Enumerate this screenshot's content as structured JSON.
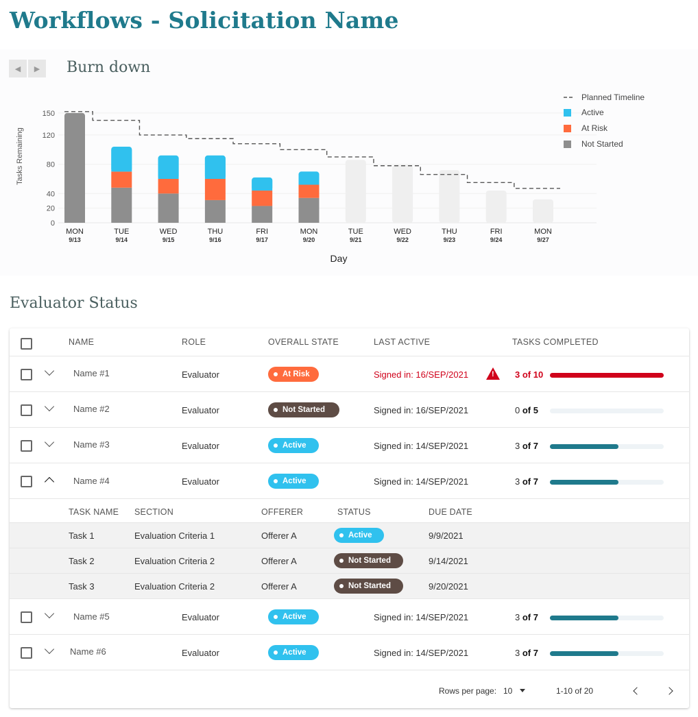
{
  "page": {
    "title": "Workflows - Solicitation Name"
  },
  "burndown": {
    "title": "Burn down",
    "prev_label": "◀",
    "next_label": "▶"
  },
  "chart_data": {
    "type": "bar",
    "xlabel": "Day",
    "ylabel": "Tasks Remaining",
    "ylim": [
      0,
      160
    ],
    "yticks": [
      0,
      20,
      40,
      80,
      120,
      150
    ],
    "categories": [
      "MON 9/13",
      "TUE 9/14",
      "WED 9/15",
      "THU 9/16",
      "FRI 9/17",
      "MON 9/20",
      "TUE 9/21",
      "WED 9/22",
      "THU 9/23",
      "FRI 9/24",
      "MON 9/27"
    ],
    "days": [
      "MON",
      "TUE",
      "WED",
      "THU",
      "FRI",
      "MON",
      "TUE",
      "WED",
      "THU",
      "FRI",
      "MON"
    ],
    "dates": [
      "9/13",
      "9/14",
      "9/15",
      "9/16",
      "9/17",
      "9/20",
      "9/21",
      "9/22",
      "9/23",
      "9/24",
      "9/27"
    ],
    "series": [
      {
        "name": "Not Started",
        "color": "#8e8e8e",
        "values": [
          150,
          48,
          40,
          31,
          23,
          34,
          null,
          null,
          null,
          null,
          null
        ]
      },
      {
        "name": "At Risk",
        "color": "#ff6b3d",
        "values": [
          0,
          22,
          20,
          29,
          21,
          18,
          null,
          null,
          null,
          null,
          null
        ]
      },
      {
        "name": "Active",
        "color": "#30c1ee",
        "values": [
          0,
          34,
          32,
          32,
          18,
          18,
          null,
          null,
          null,
          null,
          null
        ]
      }
    ],
    "projected": {
      "color": "#efefef",
      "values": [
        null,
        null,
        null,
        null,
        null,
        null,
        86,
        79,
        72,
        44,
        32
      ]
    },
    "planned_timeline": {
      "name": "Planned Timeline",
      "values": [
        152,
        140,
        120,
        115,
        108,
        100,
        90,
        78,
        66,
        55,
        47
      ]
    },
    "legend": [
      "Planned Timeline",
      "Active",
      "At Risk",
      "Not Started"
    ],
    "legend_position": "top-right",
    "grid": true
  },
  "evaluator": {
    "title": "Evaluator Status",
    "columns": {
      "name": "NAME",
      "role": "ROLE",
      "state": "OVERALL STATE",
      "last_active": "LAST ACTIVE",
      "tasks": "TASKS COMPLETED"
    },
    "rows": [
      {
        "name": "Name #1",
        "role": "Evaluator",
        "state": "At Risk",
        "last_active": "Signed in: 16/SEP/2021",
        "done": "3",
        "of_total": "of 10",
        "progress": 1.0
      },
      {
        "name": "Name #2",
        "role": "Evaluator",
        "state": "Not Started",
        "last_active": "Signed in: 16/SEP/2021",
        "done": "0",
        "of_total": "of 5",
        "progress": 0.0
      },
      {
        "name": "Name #3",
        "role": "Evaluator",
        "state": "Active",
        "last_active": "Signed in: 14/SEP/2021",
        "done": "3",
        "of_total": "of 7",
        "progress": 0.6
      },
      {
        "name": "Name #4",
        "role": "Evaluator",
        "state": "Active",
        "last_active": "Signed in: 14/SEP/2021",
        "done": "3",
        "of_total": "of 7",
        "progress": 0.6
      },
      {
        "name": "Name #5",
        "role": "Evaluator",
        "state": "Active",
        "last_active": "Signed in: 14/SEP/2021",
        "done": "3",
        "of_total": "of 7",
        "progress": 0.6
      },
      {
        "name": "Name #6",
        "role": "Evaluator",
        "state": "Active",
        "last_active": "Signed in: 14/SEP/2021",
        "done": "3",
        "of_total": "of 7",
        "progress": 0.6
      }
    ],
    "subtable": {
      "columns": {
        "task": "TASK NAME",
        "section": "SECTION",
        "offerer": "OFFERER",
        "status": "STATUS",
        "due": "DUE DATE"
      },
      "rows": [
        {
          "task": "Task 1",
          "section": "Evaluation Criteria 1",
          "offerer": "Offerer A",
          "status": "Active",
          "due": "9/9/2021"
        },
        {
          "task": "Task 2",
          "section": "Evaluation Criteria 2",
          "offerer": "Offerer A",
          "status": "Not Started",
          "due": "9/14/2021"
        },
        {
          "task": "Task 3",
          "section": "Evaluation Criteria 2",
          "offerer": "Offerer A",
          "status": "Not Started",
          "due": "9/20/2021"
        }
      ]
    },
    "footer": {
      "rows_per_page_label": "Rows per page:",
      "rows_per_page_value": "10",
      "range": "1-10 of 20"
    },
    "warning_glyph": "!",
    "colors": {
      "risk_text": "#d0021b",
      "brand": "#1f7a8c",
      "active": "#30c1ee",
      "at_risk": "#ff6b3d",
      "not_started": "#5e4c45"
    }
  }
}
